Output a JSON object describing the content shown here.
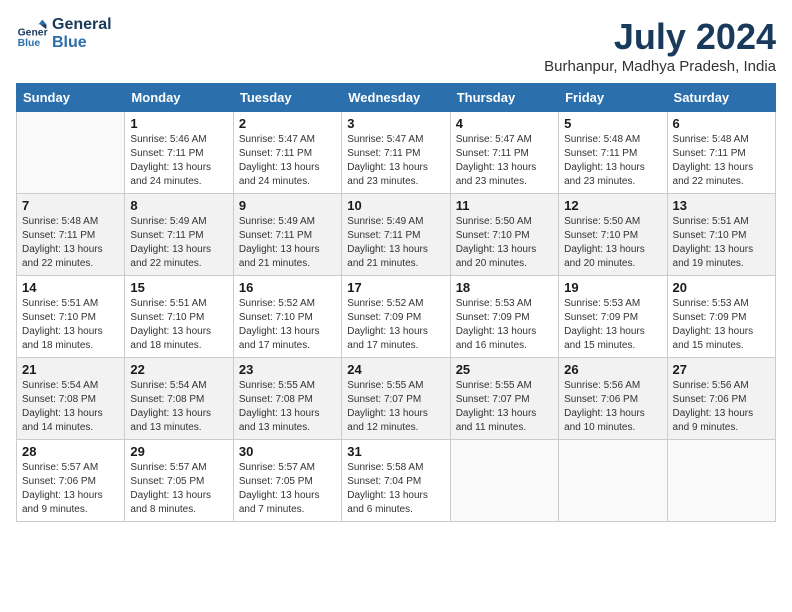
{
  "header": {
    "logo_line1": "General",
    "logo_line2": "Blue",
    "month_year": "July 2024",
    "location": "Burhanpur, Madhya Pradesh, India"
  },
  "days_of_week": [
    "Sunday",
    "Monday",
    "Tuesday",
    "Wednesday",
    "Thursday",
    "Friday",
    "Saturday"
  ],
  "weeks": [
    [
      {
        "day": "",
        "sunrise": "",
        "sunset": "",
        "daylight": ""
      },
      {
        "day": "1",
        "sunrise": "Sunrise: 5:46 AM",
        "sunset": "Sunset: 7:11 PM",
        "daylight": "Daylight: 13 hours and 24 minutes."
      },
      {
        "day": "2",
        "sunrise": "Sunrise: 5:47 AM",
        "sunset": "Sunset: 7:11 PM",
        "daylight": "Daylight: 13 hours and 24 minutes."
      },
      {
        "day": "3",
        "sunrise": "Sunrise: 5:47 AM",
        "sunset": "Sunset: 7:11 PM",
        "daylight": "Daylight: 13 hours and 23 minutes."
      },
      {
        "day": "4",
        "sunrise": "Sunrise: 5:47 AM",
        "sunset": "Sunset: 7:11 PM",
        "daylight": "Daylight: 13 hours and 23 minutes."
      },
      {
        "day": "5",
        "sunrise": "Sunrise: 5:48 AM",
        "sunset": "Sunset: 7:11 PM",
        "daylight": "Daylight: 13 hours and 23 minutes."
      },
      {
        "day": "6",
        "sunrise": "Sunrise: 5:48 AM",
        "sunset": "Sunset: 7:11 PM",
        "daylight": "Daylight: 13 hours and 22 minutes."
      }
    ],
    [
      {
        "day": "7",
        "sunrise": "Sunrise: 5:48 AM",
        "sunset": "Sunset: 7:11 PM",
        "daylight": "Daylight: 13 hours and 22 minutes."
      },
      {
        "day": "8",
        "sunrise": "Sunrise: 5:49 AM",
        "sunset": "Sunset: 7:11 PM",
        "daylight": "Daylight: 13 hours and 22 minutes."
      },
      {
        "day": "9",
        "sunrise": "Sunrise: 5:49 AM",
        "sunset": "Sunset: 7:11 PM",
        "daylight": "Daylight: 13 hours and 21 minutes."
      },
      {
        "day": "10",
        "sunrise": "Sunrise: 5:49 AM",
        "sunset": "Sunset: 7:11 PM",
        "daylight": "Daylight: 13 hours and 21 minutes."
      },
      {
        "day": "11",
        "sunrise": "Sunrise: 5:50 AM",
        "sunset": "Sunset: 7:10 PM",
        "daylight": "Daylight: 13 hours and 20 minutes."
      },
      {
        "day": "12",
        "sunrise": "Sunrise: 5:50 AM",
        "sunset": "Sunset: 7:10 PM",
        "daylight": "Daylight: 13 hours and 20 minutes."
      },
      {
        "day": "13",
        "sunrise": "Sunrise: 5:51 AM",
        "sunset": "Sunset: 7:10 PM",
        "daylight": "Daylight: 13 hours and 19 minutes."
      }
    ],
    [
      {
        "day": "14",
        "sunrise": "Sunrise: 5:51 AM",
        "sunset": "Sunset: 7:10 PM",
        "daylight": "Daylight: 13 hours and 18 minutes."
      },
      {
        "day": "15",
        "sunrise": "Sunrise: 5:51 AM",
        "sunset": "Sunset: 7:10 PM",
        "daylight": "Daylight: 13 hours and 18 minutes."
      },
      {
        "day": "16",
        "sunrise": "Sunrise: 5:52 AM",
        "sunset": "Sunset: 7:10 PM",
        "daylight": "Daylight: 13 hours and 17 minutes."
      },
      {
        "day": "17",
        "sunrise": "Sunrise: 5:52 AM",
        "sunset": "Sunset: 7:09 PM",
        "daylight": "Daylight: 13 hours and 17 minutes."
      },
      {
        "day": "18",
        "sunrise": "Sunrise: 5:53 AM",
        "sunset": "Sunset: 7:09 PM",
        "daylight": "Daylight: 13 hours and 16 minutes."
      },
      {
        "day": "19",
        "sunrise": "Sunrise: 5:53 AM",
        "sunset": "Sunset: 7:09 PM",
        "daylight": "Daylight: 13 hours and 15 minutes."
      },
      {
        "day": "20",
        "sunrise": "Sunrise: 5:53 AM",
        "sunset": "Sunset: 7:09 PM",
        "daylight": "Daylight: 13 hours and 15 minutes."
      }
    ],
    [
      {
        "day": "21",
        "sunrise": "Sunrise: 5:54 AM",
        "sunset": "Sunset: 7:08 PM",
        "daylight": "Daylight: 13 hours and 14 minutes."
      },
      {
        "day": "22",
        "sunrise": "Sunrise: 5:54 AM",
        "sunset": "Sunset: 7:08 PM",
        "daylight": "Daylight: 13 hours and 13 minutes."
      },
      {
        "day": "23",
        "sunrise": "Sunrise: 5:55 AM",
        "sunset": "Sunset: 7:08 PM",
        "daylight": "Daylight: 13 hours and 13 minutes."
      },
      {
        "day": "24",
        "sunrise": "Sunrise: 5:55 AM",
        "sunset": "Sunset: 7:07 PM",
        "daylight": "Daylight: 13 hours and 12 minutes."
      },
      {
        "day": "25",
        "sunrise": "Sunrise: 5:55 AM",
        "sunset": "Sunset: 7:07 PM",
        "daylight": "Daylight: 13 hours and 11 minutes."
      },
      {
        "day": "26",
        "sunrise": "Sunrise: 5:56 AM",
        "sunset": "Sunset: 7:06 PM",
        "daylight": "Daylight: 13 hours and 10 minutes."
      },
      {
        "day": "27",
        "sunrise": "Sunrise: 5:56 AM",
        "sunset": "Sunset: 7:06 PM",
        "daylight": "Daylight: 13 hours and 9 minutes."
      }
    ],
    [
      {
        "day": "28",
        "sunrise": "Sunrise: 5:57 AM",
        "sunset": "Sunset: 7:06 PM",
        "daylight": "Daylight: 13 hours and 9 minutes."
      },
      {
        "day": "29",
        "sunrise": "Sunrise: 5:57 AM",
        "sunset": "Sunset: 7:05 PM",
        "daylight": "Daylight: 13 hours and 8 minutes."
      },
      {
        "day": "30",
        "sunrise": "Sunrise: 5:57 AM",
        "sunset": "Sunset: 7:05 PM",
        "daylight": "Daylight: 13 hours and 7 minutes."
      },
      {
        "day": "31",
        "sunrise": "Sunrise: 5:58 AM",
        "sunset": "Sunset: 7:04 PM",
        "daylight": "Daylight: 13 hours and 6 minutes."
      },
      {
        "day": "",
        "sunrise": "",
        "sunset": "",
        "daylight": ""
      },
      {
        "day": "",
        "sunrise": "",
        "sunset": "",
        "daylight": ""
      },
      {
        "day": "",
        "sunrise": "",
        "sunset": "",
        "daylight": ""
      }
    ]
  ]
}
